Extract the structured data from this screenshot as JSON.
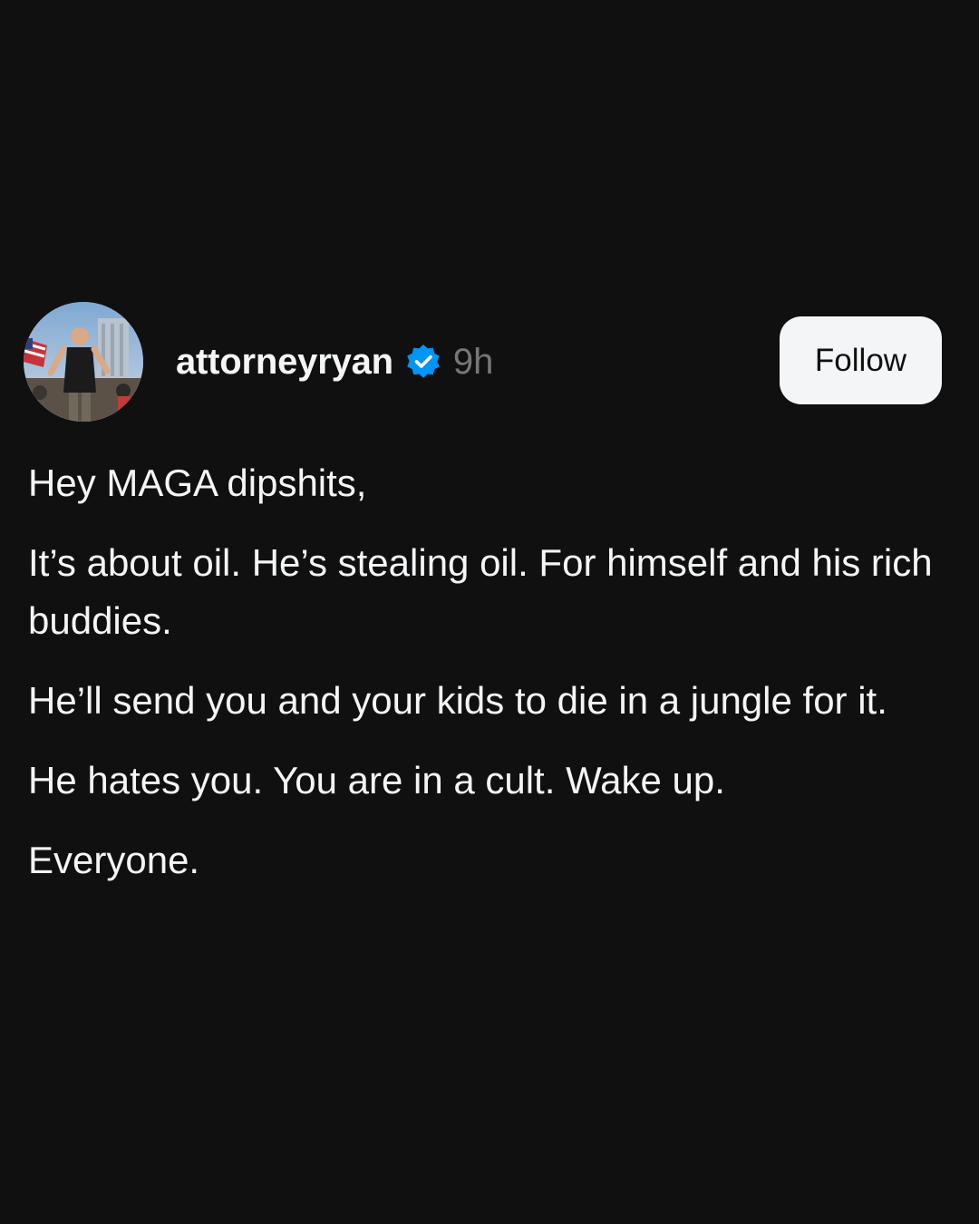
{
  "post": {
    "username": "attorneyryan",
    "verified": true,
    "time": "9h",
    "follow_label": "Follow",
    "paragraphs": [
      "Hey MAGA dipshits,",
      "It’s about oil. He’s stealing oil. For himself and his rich buddies.",
      "He’ll send you and your kids to die in a jungle for it.",
      "He hates you. You are in a cult. Wake up.",
      "Everyone."
    ]
  },
  "icons": {
    "avatar": "profile-photo",
    "verified": "verified-badge-icon"
  },
  "colors": {
    "background": "#101010",
    "text_primary": "#f3f5f7",
    "text_secondary": "#777777",
    "verified_blue": "#0095f6",
    "button_bg": "#f3f5f7"
  }
}
